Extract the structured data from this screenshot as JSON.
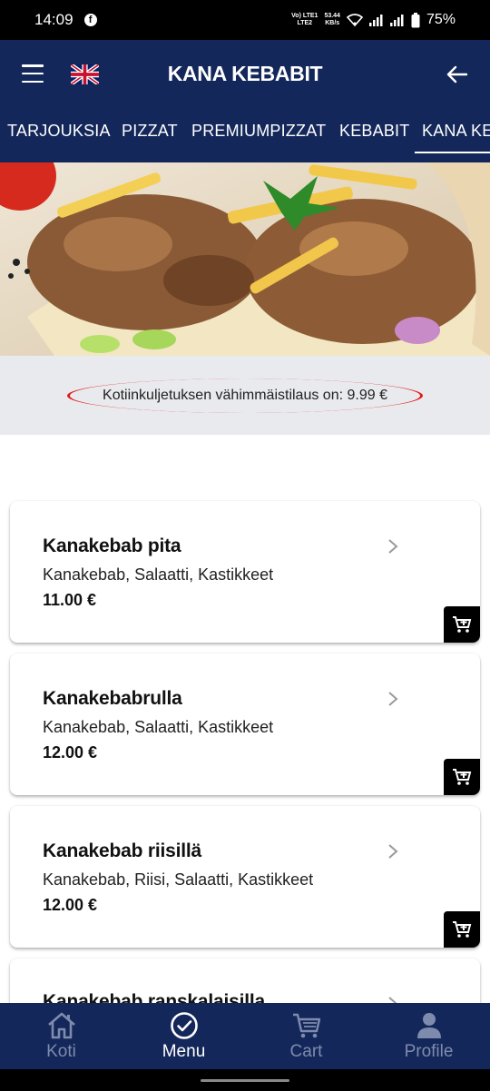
{
  "status_bar": {
    "time": "14:09",
    "network_top": "Vo) LTE1",
    "network_bottom": "LTE2",
    "speed_value": "53.44",
    "speed_unit": "KB/s",
    "battery": "75%"
  },
  "app_bar": {
    "title": "KANA KEBABIT",
    "language_flag": "uk-flag-icon"
  },
  "category_tabs": [
    {
      "label": "TARJOUKSIA",
      "active": false
    },
    {
      "label": "PIZZAT",
      "active": false
    },
    {
      "label": "PREMIUMPIZZAT",
      "active": false
    },
    {
      "label": "KEBABIT",
      "active": false
    },
    {
      "label": "KANA KEBABIT",
      "active": true
    }
  ],
  "notice": {
    "text": "Kotiinkuljetuksen vähimmäistilaus on: 9.99 €"
  },
  "products": [
    {
      "name": "Kanakebab pita",
      "description": "Kanakebab, Salaatti, Kastikkeet",
      "price": "11.00 €"
    },
    {
      "name": "Kanakebabrulla",
      "description": "Kanakebab, Salaatti, Kastikkeet",
      "price": "12.00 €"
    },
    {
      "name": "Kanakebab riisillä",
      "description": "Kanakebab, Riisi, Salaatti, Kastikkeet",
      "price": "12.00 €"
    },
    {
      "name": "Kanakebab ranskalaisilla",
      "description": "",
      "price": ""
    }
  ],
  "bottom_nav": [
    {
      "label": "Koti",
      "icon": "home-icon",
      "active": false
    },
    {
      "label": "Menu",
      "icon": "check-circle-icon",
      "active": true
    },
    {
      "label": "Cart",
      "icon": "cart-icon",
      "active": false
    },
    {
      "label": "Profile",
      "icon": "person-icon",
      "active": false
    }
  ],
  "colors": {
    "primary": "#14275a",
    "accent_red": "#e01b1b",
    "inactive_nav": "#7e8bad"
  }
}
